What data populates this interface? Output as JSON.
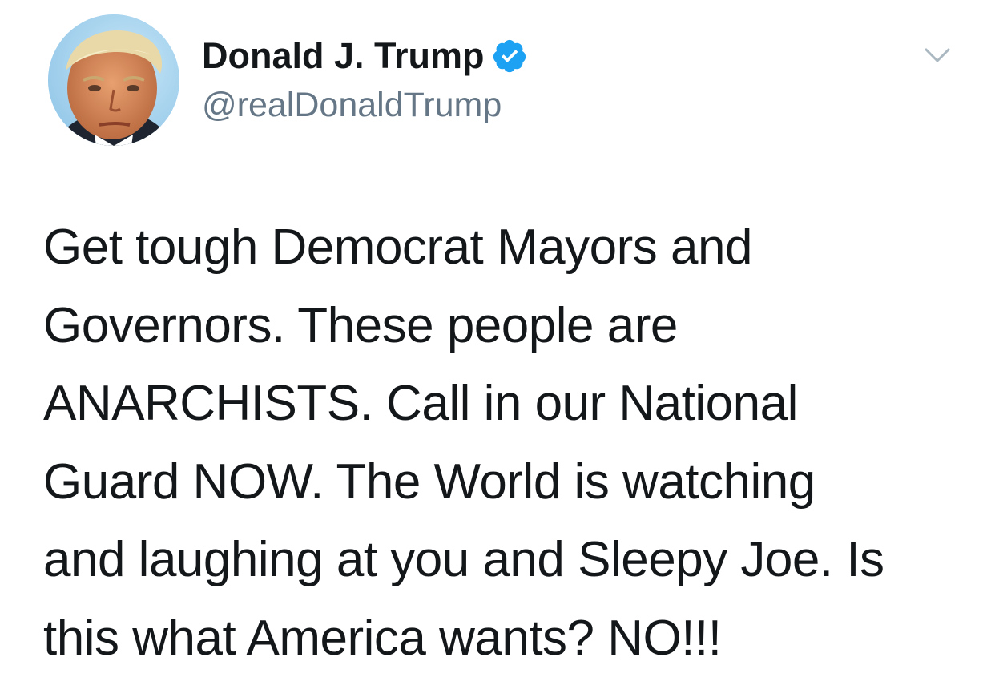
{
  "author": {
    "display_name": "Donald J. Trump",
    "handle": "@realDonaldTrump",
    "verified": true,
    "avatar_icon": "profile-photo"
  },
  "menu": {
    "icon": "chevron-down-icon"
  },
  "tweet": {
    "lines": [
      "Get tough Democrat Mayors and",
      "Governors. These people are",
      "ANARCHISTS. Call in our National",
      "Guard NOW. The World is watching",
      "and laughing at you and Sleepy Joe. Is",
      "this what America wants? NO!!!"
    ]
  },
  "colors": {
    "text": "#14171a",
    "secondary_text": "#657786",
    "verified_badge": "#1da1f2",
    "chevron": "#aab8c2"
  }
}
